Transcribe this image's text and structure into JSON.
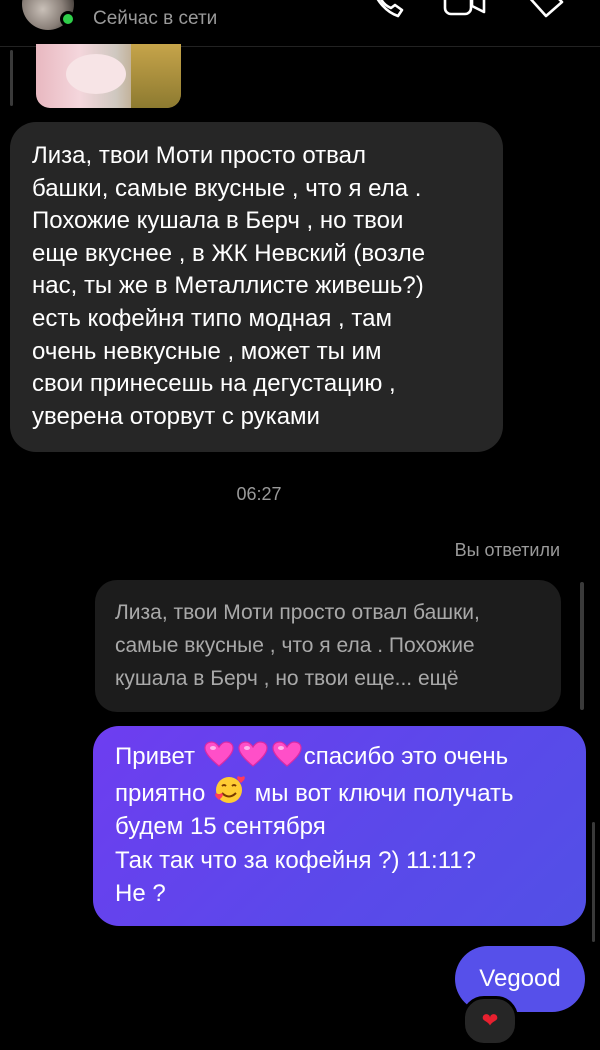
{
  "header": {
    "status": "Сейчас в сети",
    "icons": [
      "phone-icon",
      "video-camera-icon",
      "tag-icon"
    ],
    "online_color": "#2fcf4a"
  },
  "messages": {
    "incoming_text": "Лиза, твои Моти просто отвал\nбашки, самые вкусные , что я ела .\nПохожие кушала в Берч , но твои\nеще вкуснее , в ЖК Невский (возле\nнас, ты же в Металлисте живешь?)\nесть кофейня типо модная , там\nочень невкусные , может ты им\nсвои принесешь на дегустацию ,\nуверена оторвут с руками",
    "timestamp": "06:27",
    "replied_label": "Вы ответили",
    "quoted_text": "Лиза, твои Моти просто отвал башки,\nсамые вкусные , что я ела . Похожие\nкушала в Берч , но твои еще... ещё",
    "outgoing": {
      "line1_start": "Привет",
      "line1_end": "спасибо это очень",
      "line2_start": "приятно",
      "line2_end": "мы вот ключи получать",
      "line3": "будем 15 сентября",
      "line4": "Так так что за кофейня  ?)  11:11?",
      "line5": "Не ?"
    },
    "short_message": "Vegood",
    "reaction": "❤"
  },
  "colors": {
    "background": "#000000",
    "incoming_bubble": "#262626",
    "outgoing_bubble": "#5a49ea",
    "secondary_text": "#9a9a9a"
  }
}
